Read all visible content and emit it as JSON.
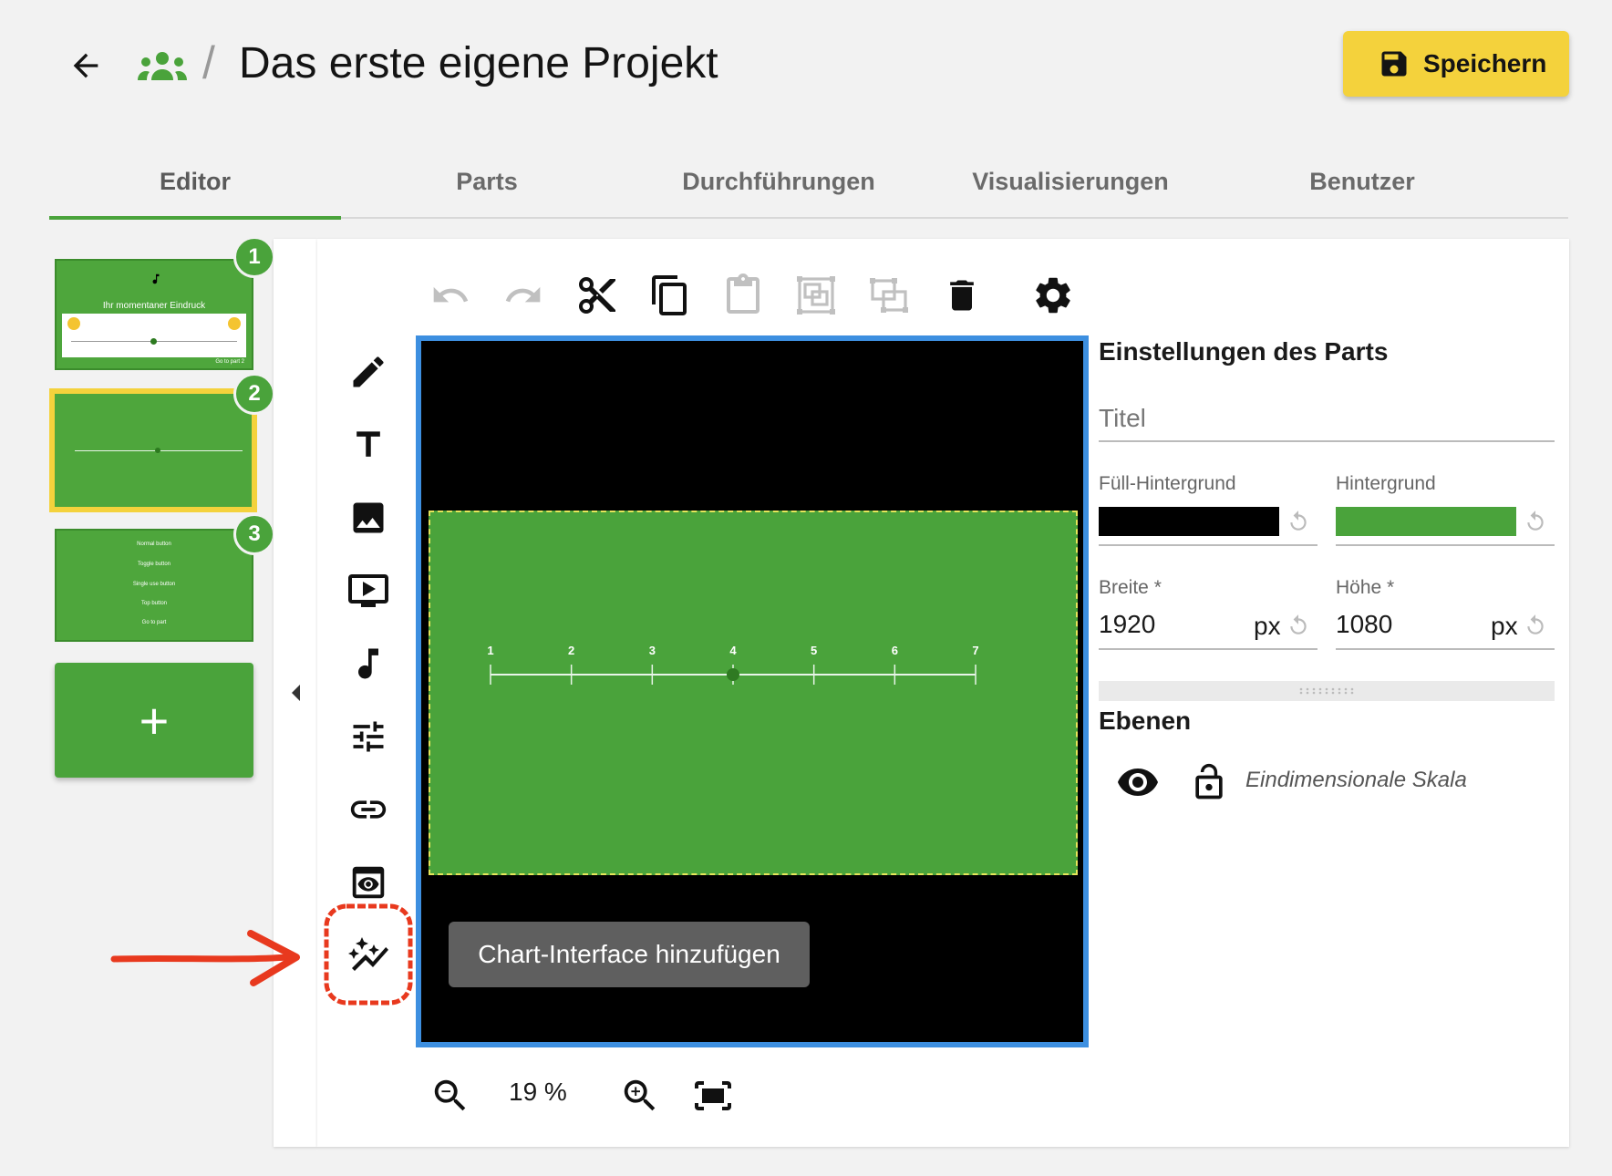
{
  "header": {
    "title": "Das erste eigene Projekt",
    "separator": "/",
    "save_label": "Speichern"
  },
  "tabs": [
    {
      "label": "Editor",
      "active": true
    },
    {
      "label": "Parts",
      "active": false
    },
    {
      "label": "Durchführungen",
      "active": false
    },
    {
      "label": "Visualisierungen",
      "active": false
    },
    {
      "label": "Benutzer",
      "active": false
    }
  ],
  "slides": [
    {
      "number": "1",
      "heading": "Ihr momentaner Eindruck",
      "footer": "Go to part 2"
    },
    {
      "number": "2",
      "selected": true,
      "scale_ticks": [
        "1",
        "2",
        "3",
        "4",
        "5",
        "6",
        "7"
      ]
    },
    {
      "number": "3",
      "buttons": [
        "Normal button",
        "Toggle button",
        "Single use button",
        "Top button",
        "Go to part"
      ]
    }
  ],
  "add_slide_label": "+",
  "canvas": {
    "scale_ticks": [
      "1",
      "2",
      "3",
      "4",
      "5",
      "6",
      "7"
    ],
    "scale_selected": 4
  },
  "tooltip": "Chart-Interface hinzufügen",
  "zoom": {
    "value": "19 %"
  },
  "settings": {
    "title": "Einstellungen des Parts",
    "title_placeholder": "Titel",
    "fill_background_label": "Füll-Hintergrund",
    "fill_background_color": "#000000",
    "background_label": "Hintergrund",
    "background_color": "#4aa33b",
    "width_label": "Breite *",
    "width_value": "1920",
    "height_label": "Höhe *",
    "height_value": "1080",
    "unit": "px"
  },
  "layers": {
    "title": "Ebenen",
    "items": [
      {
        "name": "Eindimensionale Skala"
      }
    ]
  },
  "colors": {
    "accent_green": "#4aa33b",
    "save_yellow": "#f4d23c",
    "canvas_border_blue": "#3d8fe0",
    "annotation_red": "#e8391e"
  }
}
